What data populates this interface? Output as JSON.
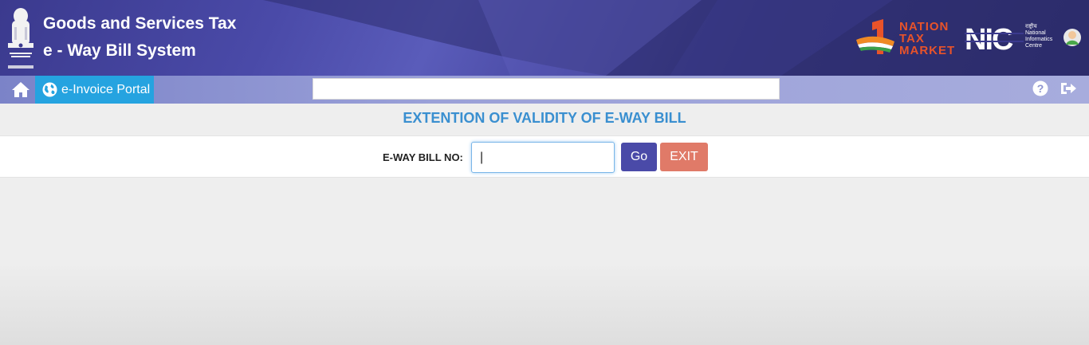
{
  "header": {
    "title_line1": "Goods and Services Tax",
    "title_line2": "e - Way Bill System",
    "logo_ontm": [
      "NATION",
      "TAX",
      "MARKET"
    ],
    "logo_nic": "NIC",
    "nic_caption": [
      "राष्ट्रीय",
      "National",
      "Informatics",
      "Centre"
    ]
  },
  "navbar": {
    "home_icon": "home-icon",
    "einvoice_label": "e-Invoice Portal",
    "einvoice_icon": "globe-icon",
    "search_value": "",
    "help_icon": "question-circle-icon",
    "logout_icon": "sign-out-icon"
  },
  "page": {
    "heading": "EXTENTION OF VALIDITY OF E-WAY BILL",
    "eway_bill_label": "E-WAY BILL NO:",
    "eway_bill_value": "|",
    "go_label": "Go",
    "exit_label": "EXIT"
  },
  "colors": {
    "header_bg": "#3b3a8e",
    "einvoice_bg": "#25a3e0",
    "heading": "#3a8fd0",
    "go_button": "#4a4aa8",
    "exit_button": "#e07a68"
  }
}
